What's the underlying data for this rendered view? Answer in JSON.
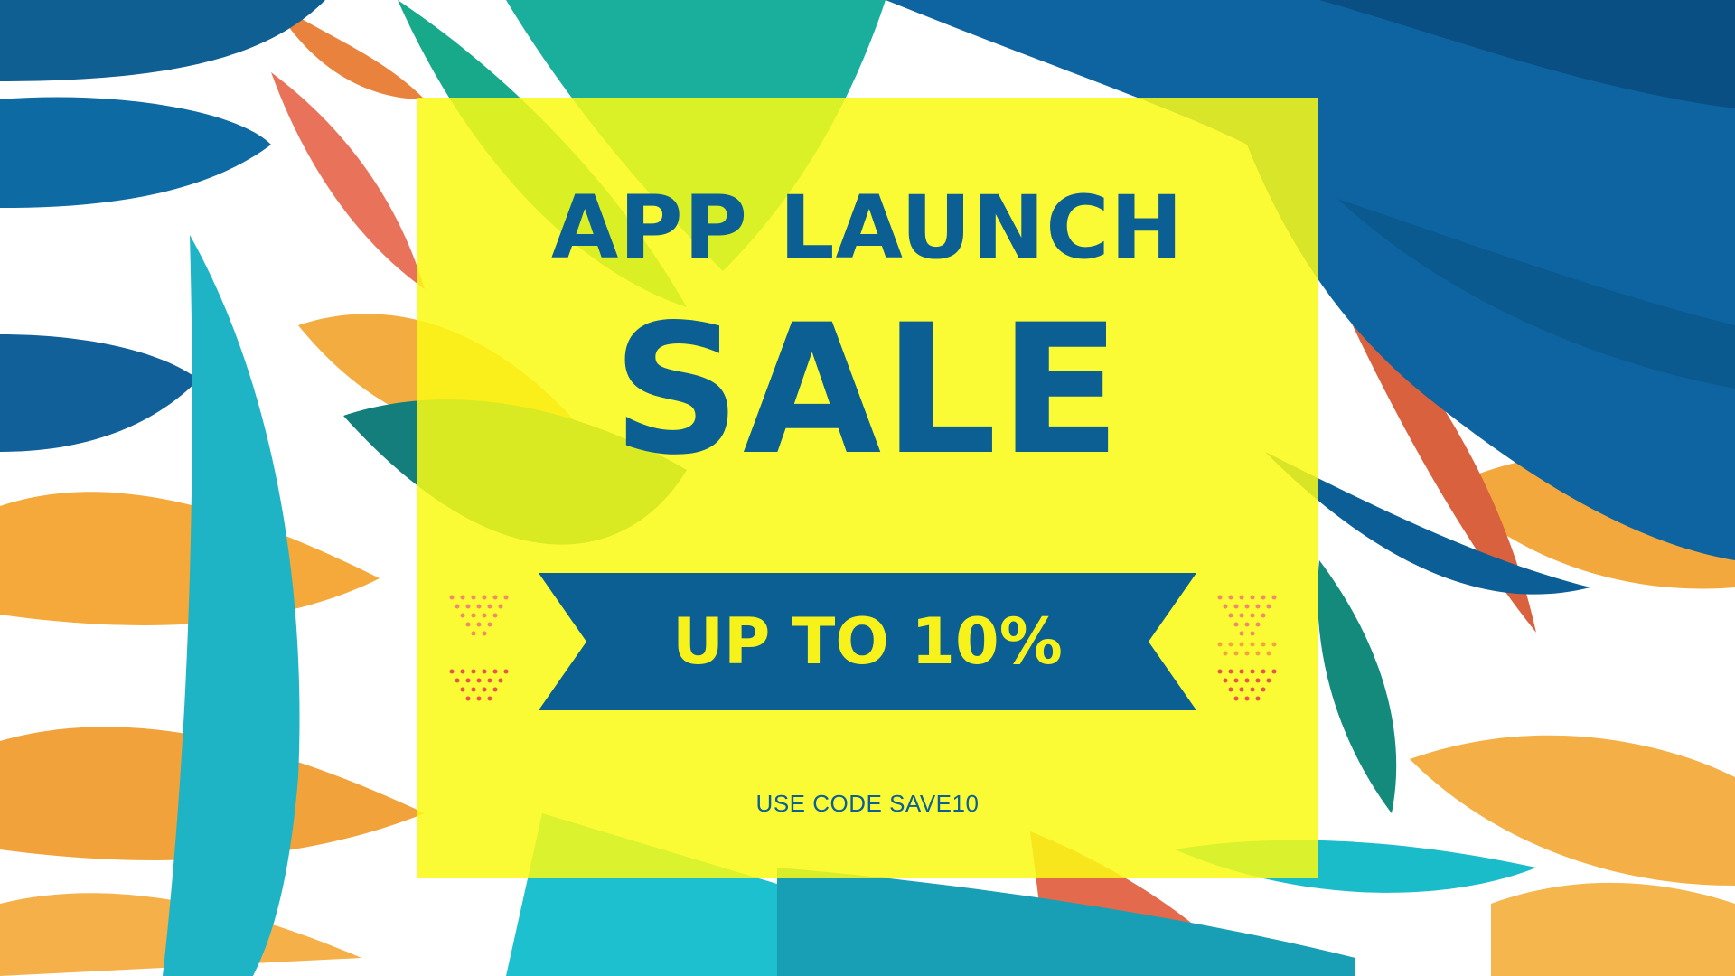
{
  "banner": {
    "title_line1": "APP LAUNCH",
    "title_line2": "SALE",
    "discount": "UP TO 10%",
    "promo": "USE CODE SAVE10"
  },
  "colors": {
    "panel": "#f9f914",
    "text": "#0b5f93",
    "ribbon": "#0b5f93",
    "ribbon_text": "#f7f31a"
  },
  "icons": [
    "tropical-leaves-background",
    "chevron-dot-pattern-left",
    "chevron-dot-pattern-right",
    "ribbon-banner"
  ]
}
